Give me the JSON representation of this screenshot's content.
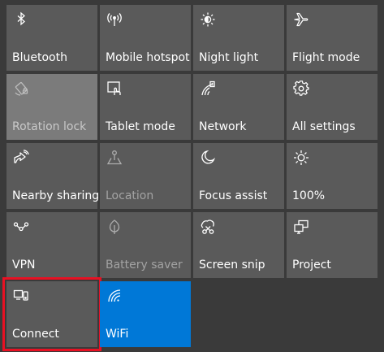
{
  "tiles": [
    {
      "label": "Bluetooth",
      "icon": "bluetooth-icon"
    },
    {
      "label": "Mobile hotspot",
      "icon": "mobile-hotspot-icon"
    },
    {
      "label": "Night light",
      "icon": "night-light-icon"
    },
    {
      "label": "Flight mode",
      "icon": "airplane-icon"
    },
    {
      "label": "Rotation lock",
      "icon": "rotation-lock-icon",
      "state": "disabled"
    },
    {
      "label": "Tablet mode",
      "icon": "tablet-mode-icon"
    },
    {
      "label": "Network",
      "icon": "network-icon"
    },
    {
      "label": "All settings",
      "icon": "gear-icon"
    },
    {
      "label": "Nearby sharing",
      "icon": "nearby-sharing-icon"
    },
    {
      "label": "Location",
      "icon": "location-icon",
      "state": "disabled"
    },
    {
      "label": "Focus assist",
      "icon": "moon-icon"
    },
    {
      "label": "100%",
      "icon": "brightness-icon"
    },
    {
      "label": "VPN",
      "icon": "vpn-icon"
    },
    {
      "label": "Battery saver",
      "icon": "battery-saver-icon",
      "state": "disabled"
    },
    {
      "label": "Screen snip",
      "icon": "screen-snip-icon"
    },
    {
      "label": "Project",
      "icon": "project-icon"
    },
    {
      "label": "Connect",
      "icon": "connect-icon",
      "state": "selected"
    },
    {
      "label": "WiFi",
      "icon": "wifi-icon",
      "state": "on"
    }
  ],
  "colors": {
    "background": "#3a3a3a",
    "tile": "#5a5a5a",
    "tile_hover": "#7b7b7b",
    "tile_on": "#0078d7",
    "selection_outline": "#e81123"
  }
}
